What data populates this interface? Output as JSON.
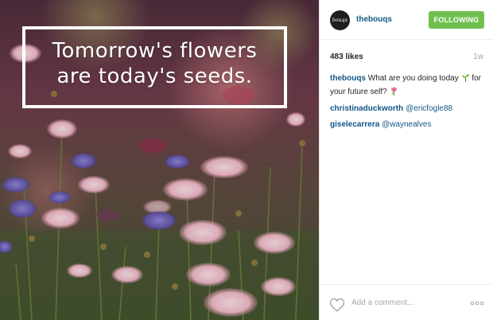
{
  "post": {
    "image": {
      "quote_line1": "Tomorrow's flowers",
      "quote_line2": "are today's seeds."
    },
    "header": {
      "avatar_text": "bouqs",
      "username": "thebouqs",
      "follow_label": "FOLLOWING"
    },
    "meta": {
      "likes": "483 likes",
      "time": "1w"
    },
    "caption": {
      "username": "thebouqs",
      "text_before": "What are you doing today",
      "text_after": "for your future self?"
    },
    "comments": [
      {
        "username": "christinaduckworth",
        "mention": "@ericfogle88"
      },
      {
        "username": "giselecarrera",
        "mention": "@waynealves"
      }
    ],
    "footer": {
      "placeholder": "Add a comment..."
    }
  },
  "icons": {
    "sprout": "sprout-icon",
    "flower": "tulip-icon",
    "like": "heart-icon",
    "more": "more-options-icon"
  },
  "colors": {
    "follow_button": "#70c050",
    "link": "#125688",
    "muted": "#a5a7aa"
  }
}
